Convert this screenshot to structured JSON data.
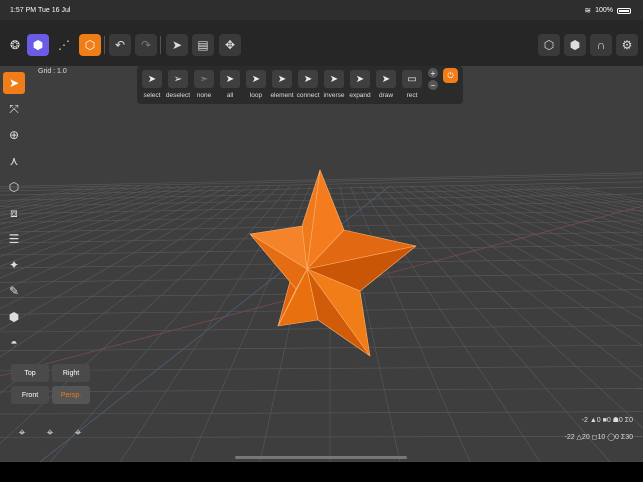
{
  "status": {
    "time": "1:57 PM",
    "date": "Tue 16 Jul",
    "battery": "100%"
  },
  "toolbar": {
    "left": [
      {
        "name": "objects-icon",
        "glyph": "❂"
      },
      {
        "name": "cube-purple-icon",
        "glyph": "⬢"
      },
      {
        "name": "vertices-icon",
        "glyph": "⋰"
      },
      {
        "name": "cube-orange-icon",
        "glyph": "⬡"
      }
    ],
    "undo": "↶",
    "redo": "↷",
    "select_tool": "➤",
    "notes": "▤",
    "transform": "✥",
    "right": [
      {
        "name": "cube-solid-icon",
        "glyph": "⬡"
      },
      {
        "name": "cube-wire-icon",
        "glyph": "⬢"
      },
      {
        "name": "magnet-icon",
        "glyph": "∩"
      },
      {
        "name": "settings-icon",
        "glyph": "⚙"
      }
    ]
  },
  "viewport": {
    "grid_label": "Grid : 1.0",
    "accent_color": "#f07d18",
    "mesh_color": "#f07d18"
  },
  "sidebar": [
    {
      "name": "pointer-tool-icon",
      "glyph": "➤",
      "active": true
    },
    {
      "name": "move-tool-icon",
      "glyph": "⤧"
    },
    {
      "name": "rotate-tool-icon",
      "glyph": "⊕"
    },
    {
      "name": "scale-tool-icon",
      "glyph": "⋏"
    },
    {
      "name": "box-tool-icon",
      "glyph": "⬡"
    },
    {
      "name": "frame-tool-icon",
      "glyph": "⧈"
    },
    {
      "name": "layers-tool-icon",
      "glyph": "☰"
    },
    {
      "name": "mesh-tool-icon",
      "glyph": "✦"
    },
    {
      "name": "pen-tool-icon",
      "glyph": "✎"
    },
    {
      "name": "cube-tool-icon",
      "glyph": "⬢"
    },
    {
      "name": "dome-tool-icon",
      "glyph": "◓"
    }
  ],
  "selection": {
    "items": [
      {
        "label": "select",
        "glyph": "➤"
      },
      {
        "label": "deselect",
        "glyph": "➢"
      },
      {
        "label": "none",
        "glyph": "➣"
      },
      {
        "label": "all",
        "glyph": "➤"
      },
      {
        "label": "loop",
        "glyph": "➤"
      },
      {
        "label": "element",
        "glyph": "➤"
      },
      {
        "label": "connect",
        "glyph": "➤"
      },
      {
        "label": "inverse",
        "glyph": "➤"
      },
      {
        "label": "expand",
        "glyph": "➤"
      },
      {
        "label": "draw",
        "glyph": "➤"
      },
      {
        "label": "rect",
        "glyph": "▭"
      }
    ],
    "plus": "+",
    "minus": "−",
    "lock": "⏻"
  },
  "views": {
    "top": "Top",
    "right": "Right",
    "front": "Front",
    "persp": "Persp."
  },
  "stats": {
    "line1": "-2 ▲0 ■0 ☗0 Σ0",
    "line2": "-22 △20 ◻10 ◯0 Σ30"
  }
}
